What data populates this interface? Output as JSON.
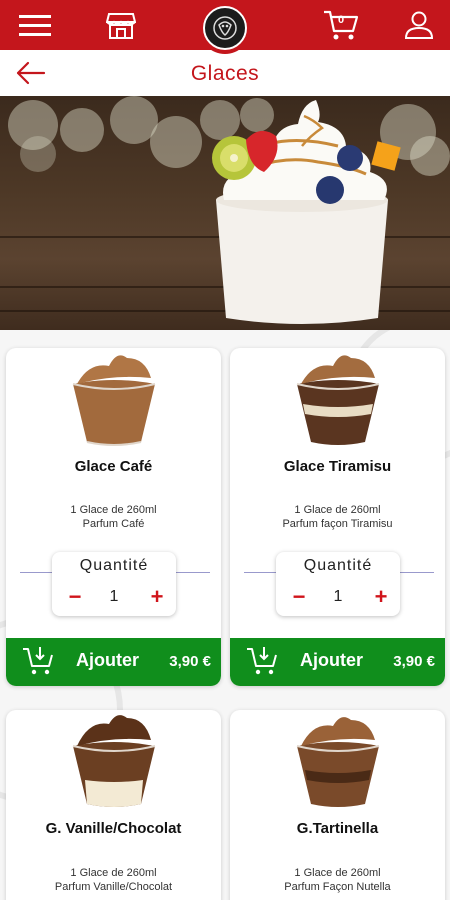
{
  "header": {
    "cart_count": "0",
    "icons": [
      "menu-icon",
      "store-icon",
      "logo",
      "cart-icon",
      "user-icon"
    ],
    "brand_color": "#c4161c"
  },
  "titlebar": {
    "title": "Glaces",
    "back_icon": "arrow-left-icon"
  },
  "products": [
    {
      "name": "Glace Café",
      "desc_line1": "1 Glace de 260ml",
      "desc_line2": "Parfum Café",
      "qty_label": "Quantité",
      "qty_value": "1",
      "add_label": "Ajouter",
      "price": "3,90 €"
    },
    {
      "name": "Glace Tiramisu",
      "desc_line1": "1 Glace de 260ml",
      "desc_line2": "Parfum façon Tiramisu",
      "qty_label": "Quantité",
      "qty_value": "1",
      "add_label": "Ajouter",
      "price": "3,90 €"
    },
    {
      "name": "G. Vanille/Chocolat",
      "desc_line1": "1 Glace de 260ml",
      "desc_line2": "Parfum Vanille/Chocolat"
    },
    {
      "name": "G.Tartinella",
      "desc_line1": "1 Glace de 260ml",
      "desc_line2": "Parfum Façon Nutella"
    }
  ],
  "qty_controls": {
    "minus": "−",
    "plus": "+"
  },
  "colors": {
    "add_button": "#108e1c",
    "accent_red": "#d0141b"
  }
}
